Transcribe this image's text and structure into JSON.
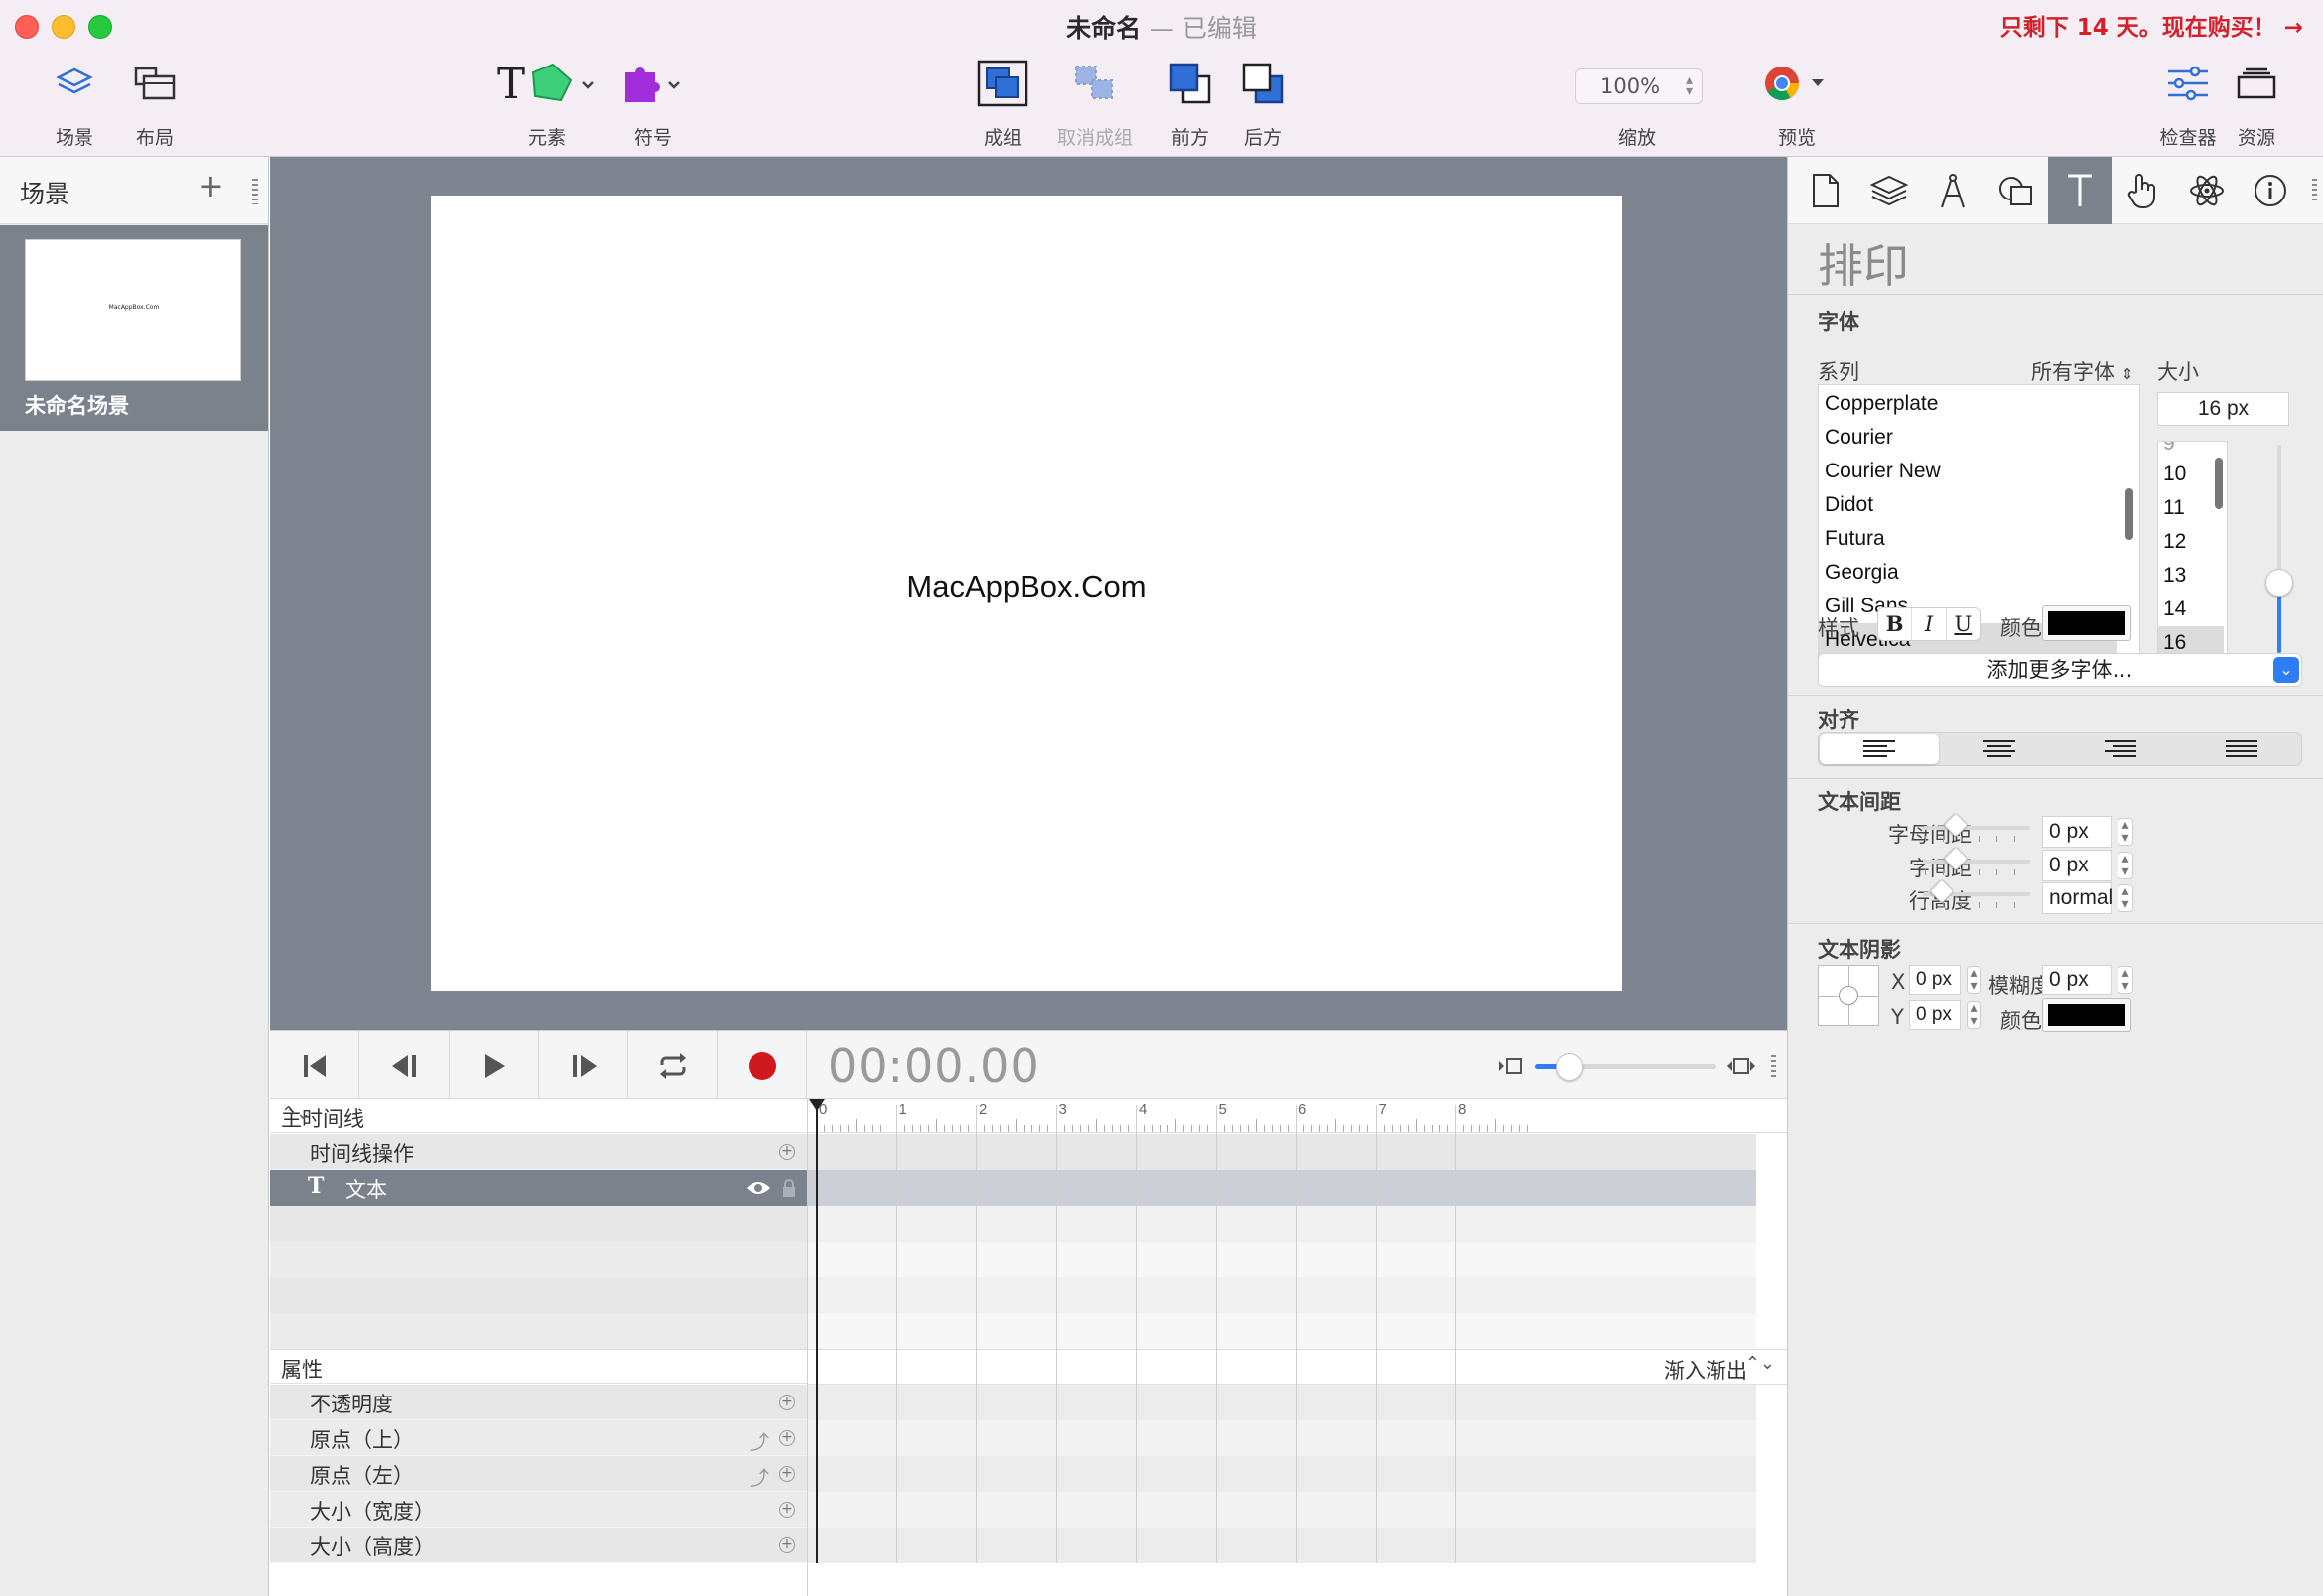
{
  "window": {
    "title": "未命名",
    "edited": "— 已编辑",
    "trial_notice": "只剩下 14 天。现在购买！ →"
  },
  "toolbar": {
    "scenes_label": "场景",
    "layout_label": "布局",
    "elements_label": "元素",
    "symbols_label": "符号",
    "group_label": "成组",
    "ungroup_label": "取消成组",
    "front_label": "前方",
    "back_label": "后方",
    "zoom_value": "100%",
    "zoom_label": "缩放",
    "preview_label": "预览",
    "inspector_label": "检查器",
    "resources_label": "资源"
  },
  "scenes_panel": {
    "title": "场景",
    "add": "+",
    "scenes": [
      {
        "name": "未命名场景",
        "thumb_text": "MacAppBox.Com"
      }
    ]
  },
  "stage": {
    "text": "MacAppBox.Com"
  },
  "timeline": {
    "timecode": "00:00.00",
    "main_timeline": "主时间线",
    "timeline_actions": "时间线操作",
    "layer_text": "文本",
    "ruler_ticks": [
      "0",
      "1",
      "2",
      "3",
      "4",
      "5",
      "6",
      "7",
      "8"
    ],
    "properties_header": "属性",
    "easing": "渐入渐出",
    "properties": [
      "不透明度",
      "原点（上）",
      "原点（左）",
      "大小（宽度）",
      "大小（高度）"
    ]
  },
  "inspector": {
    "heading": "排印",
    "font_section": "字体",
    "family_label": "系列",
    "all_fonts": "所有字体",
    "size_label": "大小",
    "size_value": "16 px",
    "fonts": [
      "Copperplate",
      "Courier",
      "Courier New",
      "Didot",
      "Futura",
      "Georgia",
      "Gill Sans",
      "Helvetica"
    ],
    "selected_font": "Helvetica",
    "sizes": [
      "9",
      "10",
      "11",
      "12",
      "13",
      "14",
      "16"
    ],
    "selected_size": "16",
    "style_label": "样式",
    "bold": "B",
    "italic": "I",
    "underline": "U",
    "color_label": "颜色",
    "text_color": "#000000",
    "add_fonts": "添加更多字体…",
    "align_section": "对齐",
    "spacing_section": "文本间距",
    "letter_spacing_label": "字母间距",
    "letter_spacing": "0 px",
    "word_spacing_label": "字间距",
    "word_spacing": "0 px",
    "line_height_label": "行高度",
    "line_height": "normal",
    "shadow_section": "文本阴影",
    "shadow_x_label": "X",
    "shadow_x": "0 px",
    "shadow_y_label": "Y",
    "shadow_y": "0 px",
    "blur_label": "模糊度",
    "blur": "0 px",
    "shadow_color_label": "颜色",
    "shadow_color": "#000000"
  }
}
